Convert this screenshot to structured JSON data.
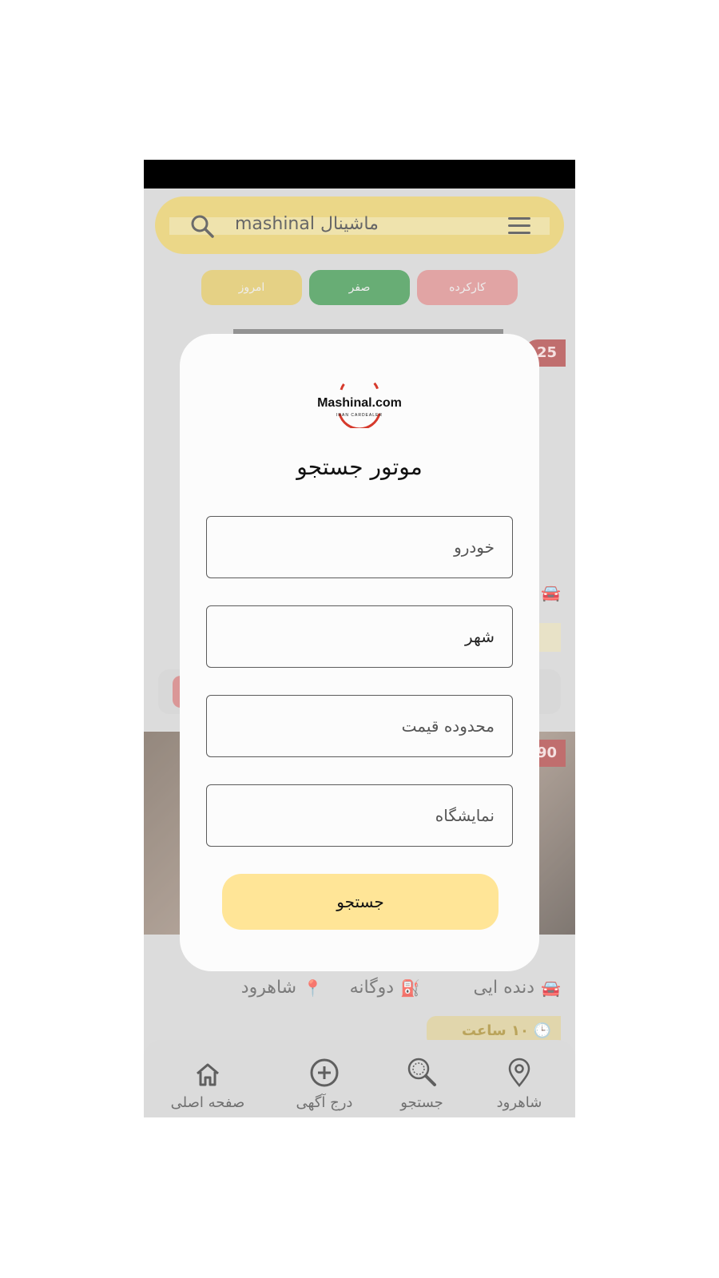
{
  "header": {
    "title": "ماشینال mashinal"
  },
  "filters": [
    {
      "label": "امروز",
      "color": "#dcbf57"
    },
    {
      "label": "صفر",
      "color": "#2f8e41"
    },
    {
      "label": "کارکرده",
      "color": "#d68282"
    }
  ],
  "listings": [
    {
      "price_fragment": "25"
    },
    {
      "price_fragment": "90",
      "color": "دنده ایی",
      "fuel": "دوگانه",
      "city": "شاهرود",
      "posted": "۱۰ ساعت پیش"
    }
  ],
  "modal": {
    "logo_text": "Mashinal.com",
    "logo_tagline": "IRAN CARDEALER",
    "title": "موتور جستجو",
    "fields": {
      "car": {
        "placeholder": "خودرو"
      },
      "city": {
        "placeholder": "شهر"
      },
      "price": {
        "placeholder": "محدوده قیمت"
      },
      "dealer": {
        "placeholder": "نمایشگاه"
      }
    },
    "submit_label": "جستجو"
  },
  "nav": {
    "items": [
      {
        "label": "صفحه اصلی",
        "icon": "home-icon"
      },
      {
        "label": "درج آگهی",
        "icon": "plus-circle-icon"
      },
      {
        "label": "جستجو",
        "icon": "magnifier-icon"
      },
      {
        "label": "شاهرود",
        "icon": "location-pin-icon"
      }
    ]
  },
  "colors": {
    "accent_yellow": "#ffe597",
    "brand_red": "#d63a2c",
    "new_green": "#2f8e41"
  }
}
